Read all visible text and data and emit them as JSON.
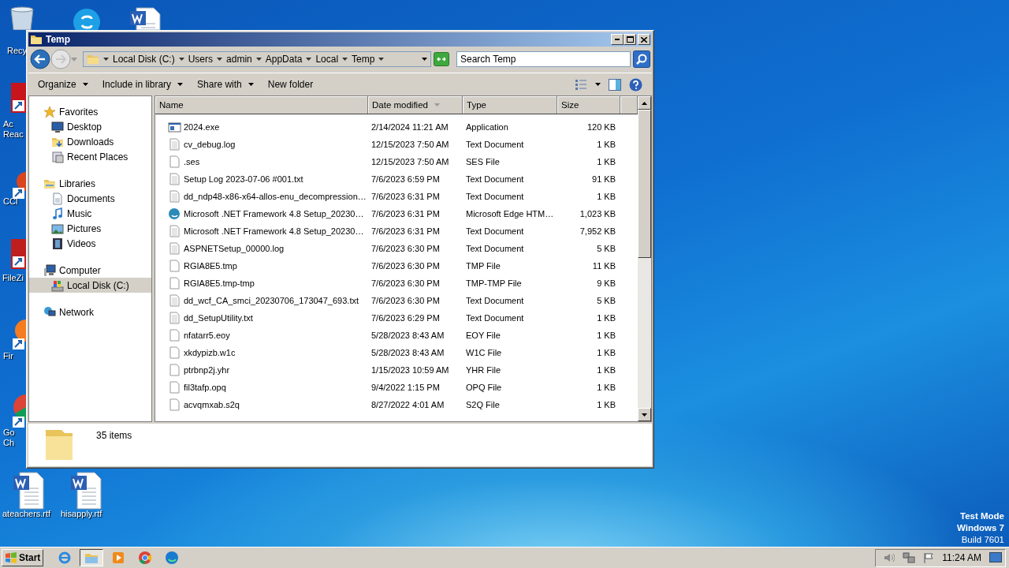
{
  "desktop_icons": [
    {
      "kind": "recycle-bin",
      "lines": [
        "Recy"
      ]
    },
    {
      "kind": "skype"
    },
    {
      "kind": "word-top"
    },
    {
      "kind": "acrobat",
      "lines": [
        "Ac",
        "Reac"
      ]
    },
    {
      "kind": "ccleaner",
      "lines": [
        "CCl"
      ]
    },
    {
      "kind": "filezilla",
      "lines": [
        "FileZi"
      ]
    },
    {
      "kind": "firefox",
      "lines": [
        "Fir"
      ]
    },
    {
      "kind": "chrome",
      "lines": [
        "Go",
        "Ch"
      ]
    },
    {
      "kind": "word",
      "lines": [
        "ateachers.rtf"
      ]
    },
    {
      "kind": "word",
      "lines": [
        "hisapply.rtf"
      ]
    }
  ],
  "desktop_text": [
    {
      "text": "Test Mode",
      "bold": true
    },
    {
      "text": "Windows 7",
      "bold": true
    },
    {
      "text": "Build 7601",
      "bold": false
    }
  ],
  "window": {
    "title": "Temp",
    "breadcrumb": [
      "Local Disk (C:)",
      "Users",
      "admin",
      "AppData",
      "Local",
      "Temp"
    ],
    "search": {
      "placeholder": "Search Temp"
    },
    "toolbar": [
      {
        "label": "Organize",
        "dropdown": true
      },
      {
        "label": "Include in library",
        "dropdown": true
      },
      {
        "label": "Share with",
        "dropdown": true
      },
      {
        "label": "New folder",
        "dropdown": false
      }
    ],
    "sidebar": [
      {
        "label": "Favorites",
        "kind": "star",
        "selected": false,
        "children": [
          {
            "label": "Desktop",
            "kind": "desktop",
            "selected": false
          },
          {
            "label": "Downloads",
            "kind": "downloads",
            "selected": false
          },
          {
            "label": "Recent Places",
            "kind": "recent",
            "selected": false
          }
        ]
      },
      {
        "label": "Libraries",
        "kind": "libraries",
        "selected": false,
        "children": [
          {
            "label": "Documents",
            "kind": "documents",
            "selected": false
          },
          {
            "label": "Music",
            "kind": "music",
            "selected": false
          },
          {
            "label": "Pictures",
            "kind": "pictures",
            "selected": false
          },
          {
            "label": "Videos",
            "kind": "videos",
            "selected": false
          }
        ]
      },
      {
        "label": "Computer",
        "kind": "computer",
        "selected": false,
        "children": [
          {
            "label": "Local Disk (C:)",
            "kind": "disk",
            "selected": true
          }
        ]
      },
      {
        "label": "Network",
        "kind": "network",
        "selected": false
      }
    ],
    "table": {
      "columns": [
        {
          "label": "Name",
          "sorted": false
        },
        {
          "label": "Date modified",
          "sorted": true
        },
        {
          "label": "Type",
          "sorted": false
        },
        {
          "label": "Size",
          "sorted": false
        }
      ],
      "rows": [
        {
          "kind": "exe",
          "name": "2024.exe",
          "date": "2/14/2024 11:21 AM",
          "type": "Application",
          "size": "120 KB"
        },
        {
          "kind": "text",
          "name": "cv_debug.log",
          "date": "12/15/2023 7:50 AM",
          "type": "Text Document",
          "size": "1 KB"
        },
        {
          "kind": "file",
          "name": ".ses",
          "date": "12/15/2023 7:50 AM",
          "type": "SES File",
          "size": "1 KB"
        },
        {
          "kind": "text",
          "name": "Setup Log 2023-07-06 #001.txt",
          "date": "7/6/2023 6:59 PM",
          "type": "Text Document",
          "size": "91 KB"
        },
        {
          "kind": "text",
          "name": "dd_ndp48-x86-x64-allos-enu_decompression…",
          "date": "7/6/2023 6:31 PM",
          "type": "Text Document",
          "size": "1 KB"
        },
        {
          "kind": "edge",
          "name": "Microsoft .NET Framework 4.8 Setup_20230…",
          "date": "7/6/2023 6:31 PM",
          "type": "Microsoft Edge HTM…",
          "size": "1,023 KB"
        },
        {
          "kind": "text",
          "name": "Microsoft .NET Framework 4.8 Setup_20230…",
          "date": "7/6/2023 6:31 PM",
          "type": "Text Document",
          "size": "7,952 KB"
        },
        {
          "kind": "text",
          "name": "ASPNETSetup_00000.log",
          "date": "7/6/2023 6:30 PM",
          "type": "Text Document",
          "size": "5 KB"
        },
        {
          "kind": "file",
          "name": "RGIA8E5.tmp",
          "date": "7/6/2023 6:30 PM",
          "type": "TMP File",
          "size": "11 KB"
        },
        {
          "kind": "file",
          "name": "RGIA8E5.tmp-tmp",
          "date": "7/6/2023 6:30 PM",
          "type": "TMP-TMP File",
          "size": "9 KB"
        },
        {
          "kind": "text",
          "name": "dd_wcf_CA_smci_20230706_173047_693.txt",
          "date": "7/6/2023 6:30 PM",
          "type": "Text Document",
          "size": "5 KB"
        },
        {
          "kind": "text",
          "name": "dd_SetupUtility.txt",
          "date": "7/6/2023 6:29 PM",
          "type": "Text Document",
          "size": "1 KB"
        },
        {
          "kind": "file",
          "name": "nfatarr5.eoy",
          "date": "5/28/2023 8:43 AM",
          "type": "EOY File",
          "size": "1 KB"
        },
        {
          "kind": "file",
          "name": "xkdypizb.w1c",
          "date": "5/28/2023 8:43 AM",
          "type": "W1C File",
          "size": "1 KB"
        },
        {
          "kind": "file",
          "name": "ptrbnp2j.yhr",
          "date": "1/15/2023 10:59 AM",
          "type": "YHR File",
          "size": "1 KB"
        },
        {
          "kind": "file",
          "name": "fil3tafp.opq",
          "date": "9/4/2022 1:15 PM",
          "type": "OPQ File",
          "size": "1 KB"
        },
        {
          "kind": "file",
          "name": "acvqmxab.s2q",
          "date": "8/27/2022 4:01 AM",
          "type": "S2Q File",
          "size": "1 KB"
        }
      ]
    },
    "status": "35 items"
  },
  "taskbar": {
    "start": "Start",
    "apps": [
      {
        "kind": "ie",
        "active": false
      },
      {
        "kind": "explorer",
        "active": true
      },
      {
        "kind": "media",
        "active": false
      },
      {
        "kind": "chrome",
        "active": false
      },
      {
        "kind": "edge",
        "active": false
      }
    ],
    "clock": "11:24 AM"
  }
}
